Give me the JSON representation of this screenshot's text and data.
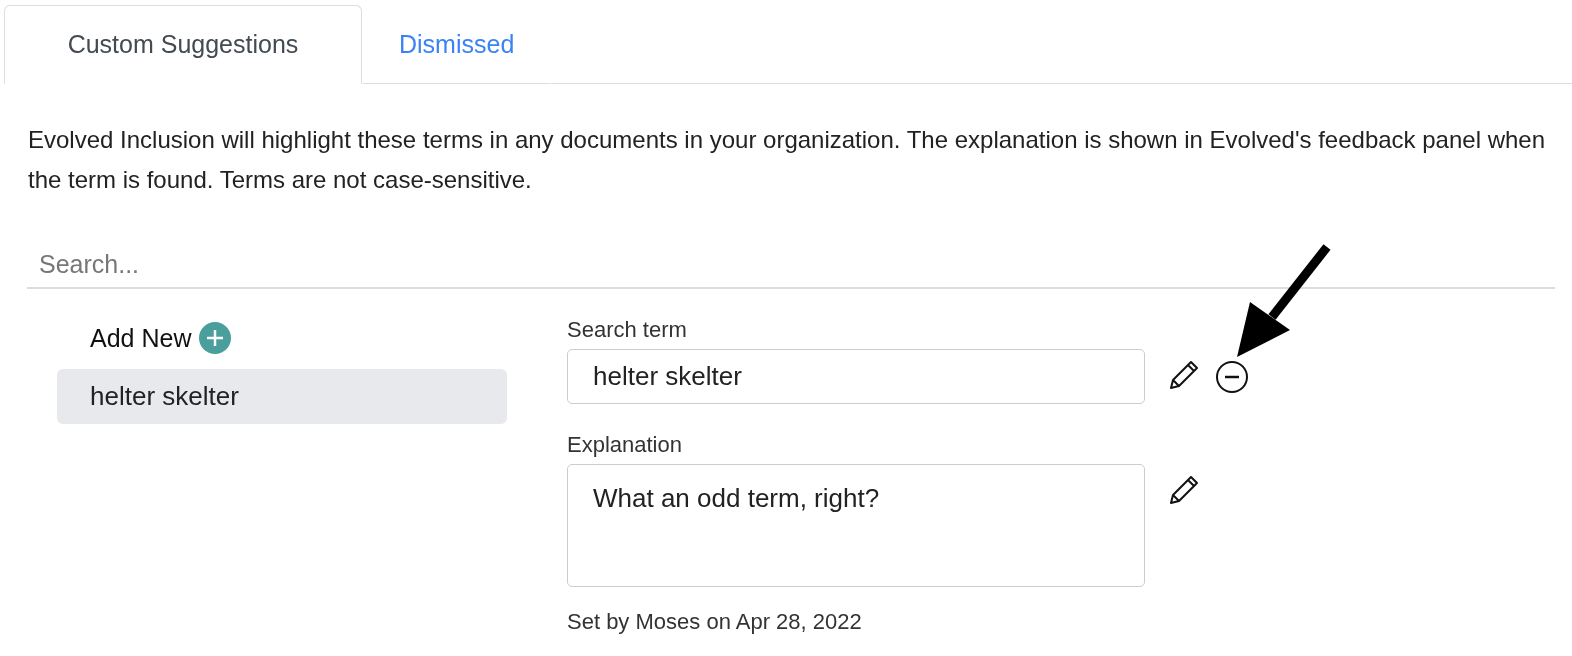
{
  "tabs": [
    {
      "label": "Custom Suggestions",
      "selected": true
    },
    {
      "label": "Dismissed",
      "selected": false
    }
  ],
  "description": "Evolved Inclusion will highlight these terms in any documents in your organization. The explanation is shown in Evolved's feedback panel when the term is found. Terms are not case-sensitive.",
  "search": {
    "placeholder": "Search..."
  },
  "add_new": {
    "label": "Add New"
  },
  "terms": [
    {
      "label": "helter skelter",
      "selected": true
    }
  ],
  "editor": {
    "fields": [
      {
        "kind": "input",
        "label": "Search term",
        "value": "helter skelter",
        "removable": true
      },
      {
        "kind": "textarea",
        "label": "Explanation",
        "value": "What an odd term, right?",
        "removable": false
      }
    ],
    "footer": "Set by Moses on Apr 28, 2022"
  }
}
